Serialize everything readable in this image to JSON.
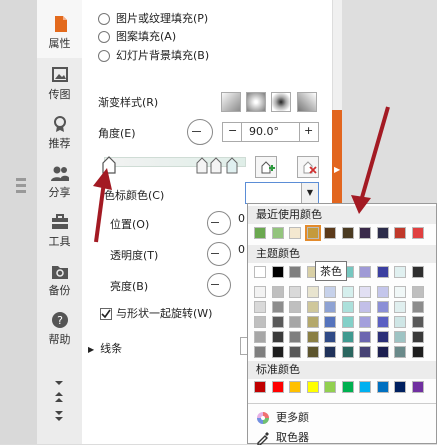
{
  "sidebar": {
    "items": [
      {
        "label": "属性",
        "icon": "property-icon"
      },
      {
        "label": "传图",
        "icon": "image-upload-icon"
      },
      {
        "label": "推荐",
        "icon": "recommend-icon"
      },
      {
        "label": "分享",
        "icon": "share-icon"
      },
      {
        "label": "工具",
        "icon": "toolbox-icon"
      },
      {
        "label": "备份",
        "icon": "backup-icon"
      },
      {
        "label": "帮助",
        "icon": "help-icon"
      }
    ]
  },
  "fill_options": [
    "图片或纹理填充(P)",
    "图案填充(A)",
    "幻灯片背景填充(B)"
  ],
  "gradient": {
    "style_label": "渐变样式(R)",
    "angle_label": "角度(E)",
    "angle_value": "90.0°",
    "minus": "−",
    "plus": "+",
    "stop_color_label": "色标颜色(C)",
    "position_label": "位置(O)",
    "transparency_label": "透明度(T)",
    "brightness_label": "亮度(B)",
    "rotate_label": "与形状一起旋转(W)",
    "line_label": "线条",
    "partial_value": "0"
  },
  "palette": {
    "recent_title": "最近使用颜色",
    "theme_title": "主题颜色",
    "standard_title": "标准颜色",
    "tooltip": "茶色",
    "more_colors": "更多颜",
    "eyedropper": "取色器",
    "recent_colors": [
      "#6aa84f",
      "#93c47d",
      "#f4e8d0",
      "#c49a3c",
      "#5b3a1a",
      "#4a3a21",
      "#3a2a4a",
      "#2c2c4a",
      "#c0392b",
      "#e04040"
    ],
    "theme_top": [
      "#ffffff",
      "#000000",
      "#7f7f7f",
      "#d9d0a6",
      "#3e5fa8",
      "#76c7c0",
      "#9f9ad6",
      "#3b3fa0",
      "#e0f0f0",
      "#2f2f2f"
    ],
    "theme_grid": [
      [
        "#f2f2f2",
        "#bfbfbf",
        "#d9d9d9",
        "#e8e4cf",
        "#c6d1ea",
        "#d5efed",
        "#e1dff3",
        "#c4c6eb",
        "#f0f7f7",
        "#bfbfbf"
      ],
      [
        "#d9d9d9",
        "#8c8c8c",
        "#bfbfbf",
        "#cfc79b",
        "#8ea2d3",
        "#ace0db",
        "#c2bfe8",
        "#8b8fd6",
        "#e0efef",
        "#8c8c8c"
      ],
      [
        "#bfbfbf",
        "#595959",
        "#a6a6a6",
        "#b4a86b",
        "#5573bc",
        "#83d0c8",
        "#a39fdc",
        "#5a5fc2",
        "#cfe6e6",
        "#595959"
      ],
      [
        "#a6a6a6",
        "#3a3a3a",
        "#7f7f7f",
        "#8a7f44",
        "#2f4a86",
        "#3f9a90",
        "#6c66b0",
        "#2b2f78",
        "#9ec4c4",
        "#3a3a3a"
      ],
      [
        "#7f7f7f",
        "#1e1e1e",
        "#595959",
        "#5c542d",
        "#1f3159",
        "#2a665f",
        "#474375",
        "#1c1f50",
        "#6a8a8a",
        "#1e1e1e"
      ]
    ],
    "standard_colors": [
      "#c00000",
      "#ff0000",
      "#ffc000",
      "#ffff00",
      "#92d050",
      "#00b050",
      "#00b0f0",
      "#0070c0",
      "#002060",
      "#7030a0"
    ]
  }
}
